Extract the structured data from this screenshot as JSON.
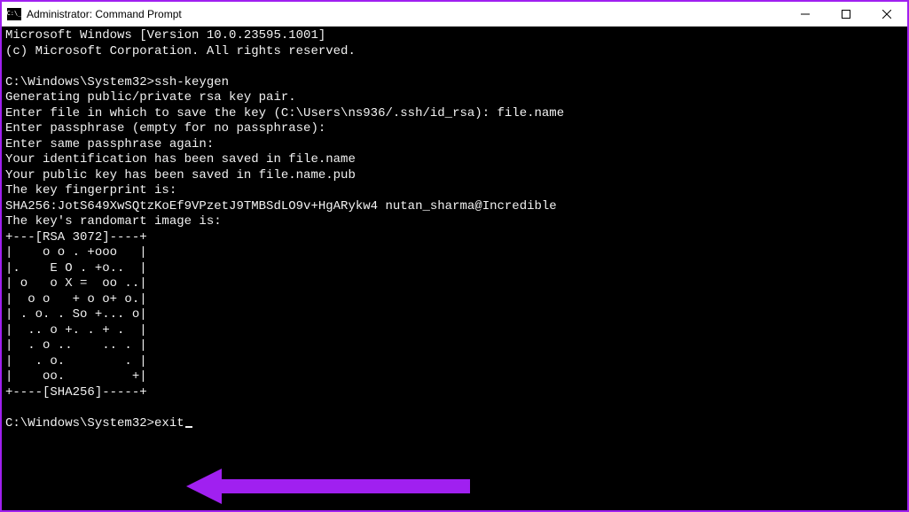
{
  "titlebar": {
    "title": "Administrator: Command Prompt"
  },
  "console": {
    "lines": [
      "Microsoft Windows [Version 10.0.23595.1001]",
      "(c) Microsoft Corporation. All rights reserved.",
      "",
      "C:\\Windows\\System32>ssh-keygen",
      "Generating public/private rsa key pair.",
      "Enter file in which to save the key (C:\\Users\\ns936/.ssh/id_rsa): file.name",
      "Enter passphrase (empty for no passphrase):",
      "Enter same passphrase again:",
      "Your identification has been saved in file.name",
      "Your public key has been saved in file.name.pub",
      "The key fingerprint is:",
      "SHA256:JotS649XwSQtzKoEf9VPzetJ9TMBSdLO9v+HgARykw4 nutan_sharma@Incredible",
      "The key's randomart image is:",
      "+---[RSA 3072]----+",
      "|    o o . +ooo   |",
      "|.    E O . +o..  |",
      "| o   o X =  oo ..|",
      "|  o o   + o o+ o.|",
      "| . o. . So +... o|",
      "|  .. o +. . + .  |",
      "|  . o ..    .. . |",
      "|   . o.        . |",
      "|    oo.         +|",
      "+----[SHA256]-----+",
      ""
    ],
    "prompt_prefix": "C:\\Windows\\System32>",
    "prompt_command": "exit"
  },
  "arrow": {
    "color": "#a020f0"
  }
}
